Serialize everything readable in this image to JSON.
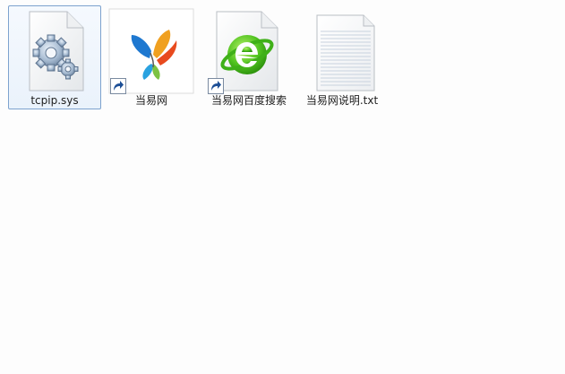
{
  "files": [
    {
      "name": "tcpip.sys",
      "icon": "system-gear-file-icon",
      "selected": true,
      "shortcut": false
    },
    {
      "name": "当易网",
      "icon": "colorful-butterfly-logo-icon",
      "selected": false,
      "shortcut": true
    },
    {
      "name": "当易网百度搜索",
      "icon": "green-e-browser-file-icon",
      "selected": false,
      "shortcut": true
    },
    {
      "name": "当易网说明.txt",
      "icon": "text-document-icon",
      "selected": false,
      "shortcut": false
    }
  ],
  "colors": {
    "selection_border": "#7da2ce",
    "selection_fill": "#eaf2fb",
    "background": "#fdfdfd"
  }
}
